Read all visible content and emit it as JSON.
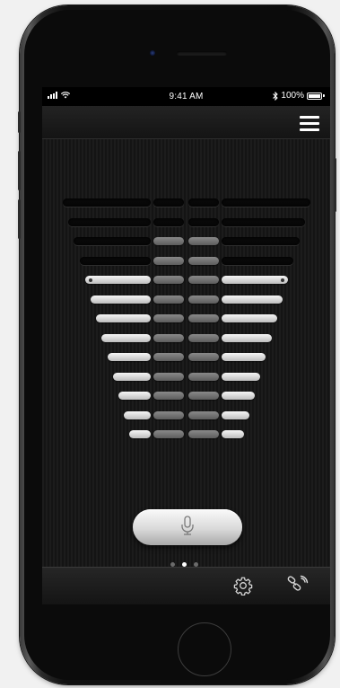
{
  "status_bar": {
    "time": "9:41 AM",
    "battery": "100%",
    "icons": [
      "signal-icon",
      "wifi-icon",
      "bluetooth-icon",
      "battery-icon"
    ]
  },
  "nav_bar": {
    "menu_icon": "hamburger-menu-icon"
  },
  "equalizer": {
    "rows": [
      [
        "off",
        "off",
        "off",
        "off"
      ],
      [
        "off",
        "off",
        "off",
        "off"
      ],
      [
        "off",
        "mid",
        "mid",
        "off"
      ],
      [
        "off",
        "mid",
        "mid",
        "off"
      ],
      [
        "on",
        "mid",
        "mid",
        "on"
      ],
      [
        "on",
        "mid",
        "mid",
        "on"
      ],
      [
        "on",
        "mid",
        "mid",
        "on"
      ],
      [
        "on",
        "mid",
        "mid",
        "on"
      ],
      [
        "on",
        "mid",
        "mid",
        "on"
      ],
      [
        "on",
        "mid",
        "mid",
        "on"
      ],
      [
        "on",
        "mid",
        "mid",
        "on"
      ],
      [
        "on",
        "mid",
        "mid",
        "on"
      ],
      [
        "on",
        "mid",
        "mid",
        "on"
      ]
    ],
    "colors": {
      "on": "#e6e6e6",
      "mid": "#7a7a7a",
      "off": "#0a0a0a"
    }
  },
  "mic_button": {
    "icon": "microphone-icon"
  },
  "pagination": {
    "count": 3,
    "active_index": 1
  },
  "bottom_bar": {
    "icons": [
      "gear-icon",
      "satellite-link-icon"
    ]
  },
  "device": {
    "frame_color": "#111111",
    "accent": "#ffffff"
  }
}
